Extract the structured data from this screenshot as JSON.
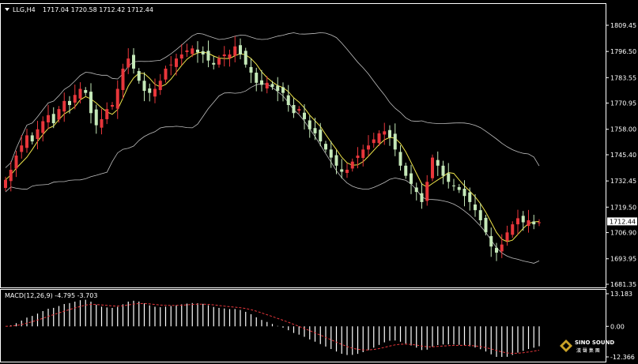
{
  "header": {
    "symbol": "LLG,H4",
    "ohlc": "1717.04 1720.58 1712.42 1712.44"
  },
  "macd_header": {
    "label": "MACD(12,26,9) -4.795 -3.703"
  },
  "logo": {
    "name": "SINO SOUND",
    "subtitle": "漢 聲 集 團"
  },
  "colors": {
    "background": "#000000",
    "axis": "#ffffff",
    "bull_candle": "#e8363b",
    "bear_candle": "#c4e8b8",
    "ma_line": "#f0e64a",
    "bollinger": "#bfbfbf",
    "macd_hist": "#ffffff",
    "macd_signal": "#e8363b"
  },
  "chart_data": [
    {
      "type": "candlestick",
      "title": "LLG,H4",
      "y_tick_labels": [
        "1809.45",
        "1796.50",
        "1783.55",
        "1770.95",
        "1758.00",
        "1745.40",
        "1732.45",
        "1719.50",
        "1706.90",
        "1693.95",
        "1681.35"
      ],
      "ylim": [
        1681.35,
        1813.0
      ],
      "current_price": "1712.44",
      "grid": false,
      "overlays": [
        "moving-average",
        "bollinger-bands"
      ],
      "close": [
        1733,
        1738,
        1745,
        1750,
        1755,
        1752,
        1758,
        1762,
        1765,
        1761,
        1768,
        1772,
        1770,
        1775,
        1778,
        1776,
        1766,
        1760,
        1763,
        1768,
        1770,
        1778,
        1788,
        1793,
        1788,
        1782,
        1777,
        1776,
        1778,
        1782,
        1788,
        1790,
        1793,
        1795,
        1797,
        1798,
        1796,
        1795,
        1792,
        1790,
        1793,
        1795,
        1795,
        1799,
        1795,
        1790,
        1786,
        1781,
        1780,
        1781,
        1779,
        1777,
        1776,
        1770,
        1766,
        1768,
        1763,
        1758,
        1756,
        1752,
        1748,
        1744,
        1740,
        1737,
        1738,
        1742,
        1745,
        1748,
        1750,
        1753,
        1756,
        1757,
        1754,
        1748,
        1740,
        1735,
        1731,
        1727,
        1722,
        1732,
        1744,
        1740,
        1735,
        1732,
        1730,
        1728,
        1725,
        1722,
        1718,
        1713,
        1707,
        1700,
        1697,
        1701,
        1707,
        1711,
        1714,
        1712,
        1713,
        1711,
        1712
      ]
    },
    {
      "type": "bar",
      "title": "MACD(12,26,9)",
      "series": [
        {
          "name": "MACD",
          "values": [
            -4.795
          ]
        },
        {
          "name": "Signal",
          "values": [
            -3.703
          ]
        }
      ],
      "y_tick_labels": [
        "13.183",
        "0.00",
        "-12.366"
      ],
      "ylim": [
        -12.366,
        13.183
      ]
    }
  ]
}
